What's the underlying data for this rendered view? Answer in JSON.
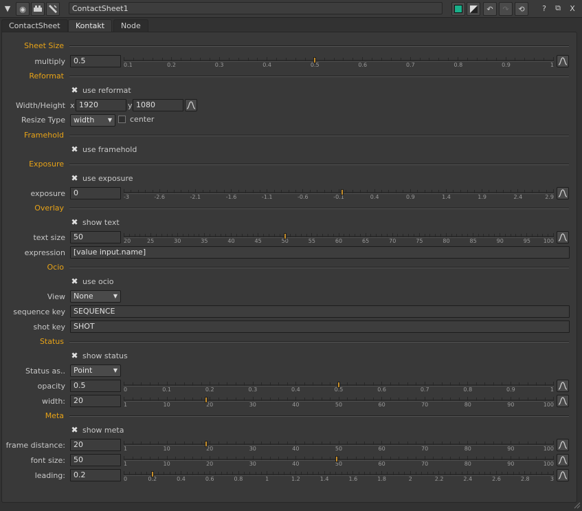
{
  "window": {
    "node_name": "ContactSheet1",
    "tabs": [
      "ContactSheet",
      "Kontakt",
      "Node"
    ],
    "active_tab": 1,
    "toolbar_icons": [
      "collapse-icon",
      "viewer-icon",
      "camera-icon",
      "wrench-icon",
      "color-swatch-icon",
      "monochrome-icon",
      "undo-icon",
      "redo-icon",
      "revert-icon",
      "help-icon",
      "float-icon",
      "close-icon"
    ],
    "help_label": "?",
    "close_label": "X"
  },
  "sections": {
    "sheet_size": "Sheet Size",
    "reformat": "Reformat",
    "framehold": "Framehold",
    "exposure": "Exposure",
    "overlay": "Overlay",
    "ocio": "Ocio",
    "status": "Status",
    "meta": "Meta"
  },
  "labels": {
    "multiply": "multiply",
    "width_height": "Width/Height",
    "x": "x",
    "y": "y",
    "resize_type": "Resize Type",
    "exposure": "exposure",
    "text_size": "text size",
    "expression": "expression",
    "view": "View",
    "sequence_key": "sequence key",
    "shot_key": "shot key",
    "status_as": "Status as..",
    "opacity": "opacity",
    "width": "width:",
    "frame_distance": "frame distance:",
    "font_size": "font size:",
    "leading": "leading:"
  },
  "checkboxes": {
    "use_reformat": {
      "label": "use reformat",
      "checked": true
    },
    "center": {
      "label": "center",
      "checked": false
    },
    "use_framehold": {
      "label": "use framehold",
      "checked": true
    },
    "use_exposure": {
      "label": "use exposure",
      "checked": true
    },
    "show_text": {
      "label": "show text",
      "checked": true
    },
    "use_ocio": {
      "label": "use ocio",
      "checked": true
    },
    "show_status": {
      "label": "show status",
      "checked": true
    },
    "show_meta": {
      "label": "show meta",
      "checked": true
    }
  },
  "values": {
    "multiply": "0.5",
    "width": "1920",
    "height": "1080",
    "resize_type": "width",
    "exposure": "0",
    "text_size": "50",
    "expression": "[value input.name]",
    "view": "None",
    "sequence_key": "SEQUENCE",
    "shot_key": "SHOT",
    "status_as": "Point",
    "opacity": "0.5",
    "status_width": "20",
    "frame_distance": "20",
    "font_size": "50",
    "leading": "0.2"
  },
  "sliders": {
    "multiply": {
      "min": 0.1,
      "max": 1,
      "value": 0.5,
      "ticks": [
        "0.1",
        "0.2",
        "0.3",
        "0.4",
        "0.5",
        "0.6",
        "0.7",
        "0.8",
        "0.9",
        "1"
      ]
    },
    "exposure": {
      "min": -3,
      "max": 2.9,
      "value": 0,
      "ticks": [
        "-3",
        "-2.6",
        "-2.1",
        "-1.6",
        "-1.1",
        "-0.6",
        "-0.1",
        "0.4",
        "0.9",
        "1.4",
        "1.9",
        "2.4",
        "2.9"
      ]
    },
    "text_size": {
      "min": 20,
      "max": 100,
      "value": 50,
      "ticks": [
        "20",
        "25",
        "30",
        "35",
        "40",
        "45",
        "50",
        "55",
        "60",
        "65",
        "70",
        "75",
        "80",
        "85",
        "90",
        "95",
        "100"
      ]
    },
    "opacity": {
      "min": 0,
      "max": 1,
      "value": 0.5,
      "ticks": [
        "0",
        "0.1",
        "0.2",
        "0.3",
        "0.4",
        "0.5",
        "0.6",
        "0.7",
        "0.8",
        "0.9",
        "1"
      ]
    },
    "status_width": {
      "min": 1,
      "max": 100,
      "value": 20,
      "ticks": [
        "1",
        "10",
        "20",
        "30",
        "40",
        "50",
        "60",
        "70",
        "80",
        "90",
        "100"
      ]
    },
    "frame_distance": {
      "min": 1,
      "max": 100,
      "value": 20,
      "ticks": [
        "1",
        "10",
        "20",
        "30",
        "40",
        "50",
        "60",
        "70",
        "80",
        "90",
        "100"
      ]
    },
    "font_size": {
      "min": 1,
      "max": 100,
      "value": 50,
      "ticks": [
        "1",
        "10",
        "20",
        "30",
        "40",
        "50",
        "60",
        "70",
        "80",
        "90",
        "100"
      ]
    },
    "leading": {
      "min": 0,
      "max": 3,
      "value": 0.2,
      "ticks": [
        "0",
        "0.2",
        "0.4",
        "0.6",
        "0.8",
        "1",
        "1.2",
        "1.4",
        "1.6",
        "1.8",
        "2",
        "2.2",
        "2.4",
        "2.6",
        "2.8",
        "3"
      ]
    }
  },
  "colors": {
    "accent": "#e8a317",
    "handle": "#c78f2b",
    "swatch": "#19b08a"
  }
}
